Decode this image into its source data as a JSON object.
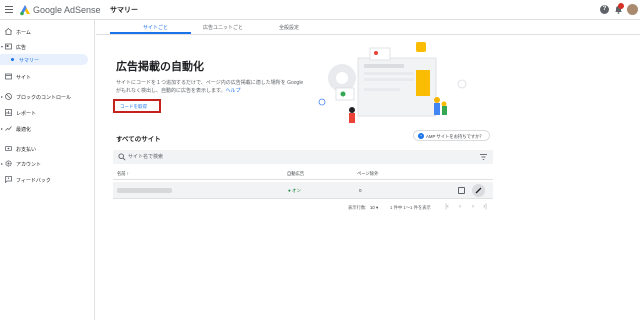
{
  "header": {
    "brand": "Google AdSense",
    "page_title": "サマリー",
    "help_glyph": "?"
  },
  "sidebar": {
    "items": [
      {
        "label": "ホーム",
        "icon": "home-icon"
      },
      {
        "label": "広告",
        "icon": "ads-icon"
      },
      {
        "label": "サマリー",
        "icon": "dot-icon"
      },
      {
        "label": "サイト",
        "icon": "sites-icon"
      },
      {
        "label": "ブロックのコントロール",
        "icon": "block-icon"
      },
      {
        "label": "レポート",
        "icon": "reports-icon"
      },
      {
        "label": "最適化",
        "icon": "optimize-icon"
      },
      {
        "label": "お支払い",
        "icon": "payments-icon"
      },
      {
        "label": "アカウント",
        "icon": "gear-icon"
      },
      {
        "label": "フィードバック",
        "icon": "feedback-icon"
      }
    ]
  },
  "tabs": [
    {
      "label": "サイトごと",
      "active": true
    },
    {
      "label": "広告ユニットごと",
      "active": false
    },
    {
      "label": "全般設定",
      "active": false
    }
  ],
  "hero": {
    "title": "広告掲載の自動化",
    "description_1": "サイトにコードを１つ追加するだけで、ページ内の広告掲載に適した場所を Google",
    "description_2": "がもれなく検出し、自動的に広告を表示します。",
    "help_link": "ヘルプ",
    "code_button": "コードを取得"
  },
  "sites": {
    "title": "すべてのサイト",
    "amp_button": "AMP サイトをお持ちですか？",
    "search_placeholder": "サイト名で検索",
    "columns": {
      "name": "名前 ↑",
      "auto_ads": "自動広告",
      "page_exclusions": "ページ除外"
    },
    "rows": [
      {
        "auto_ads": "● オン",
        "page_exclusions": "0"
      }
    ]
  },
  "pagination": {
    "rows_label": "表示行数:",
    "rows_value": "10 ▾",
    "range": "1 件中 1〜1 件を表示"
  },
  "colors": {
    "accent": "#1a73e8",
    "highlight": "#c5221f",
    "status_on": "#188038"
  }
}
